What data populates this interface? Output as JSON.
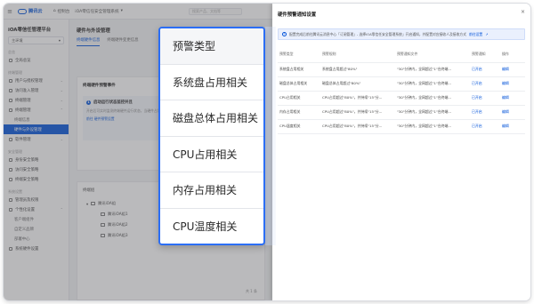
{
  "topnav": {
    "brand": "腾讯云",
    "console": "控制台",
    "app": "iOA零信任安全管理系统",
    "search_placeholder": "搜索产品、文档等"
  },
  "sidebar": {
    "title": "iOA零信任管理平台",
    "env": "主环境",
    "groups": [
      "总览",
      "终端管理",
      "安全管理",
      "系统设置"
    ],
    "items": [
      {
        "label": "全局总览",
        "level": 1
      },
      {
        "label": "用户与授权管理",
        "level": 1
      },
      {
        "label": "访问准入管理",
        "level": 1
      },
      {
        "label": "终端管理",
        "level": 1
      },
      {
        "label": "终端管理",
        "level": 1
      },
      {
        "label": "终端信息",
        "level": 2
      },
      {
        "label": "硬件与外设管理",
        "level": 2,
        "active": true
      },
      {
        "label": "软件管理",
        "level": 1
      },
      {
        "label": "身份安全策略",
        "level": 1
      },
      {
        "label": "访问安全策略",
        "level": 1
      },
      {
        "label": "终端安全策略",
        "level": 1
      },
      {
        "label": "管理员及权限",
        "level": 1
      },
      {
        "label": "个性化设置",
        "level": 1
      },
      {
        "label": "客户端组件",
        "level": 2
      },
      {
        "label": "自定义品牌",
        "level": 2
      },
      {
        "label": "部署中心",
        "level": 2
      },
      {
        "label": "系统硬件设置",
        "level": 1
      }
    ]
  },
  "main": {
    "page_title": "硬件与外设管理",
    "tabs": [
      "终端硬件信息",
      "终端硬件变更信息"
    ],
    "card_title": "终端硬件预警事件",
    "notice_title": "启动运行状态监控并且",
    "notice_desc": "开启后可实时监测终端硬件运行状态，当硬件占用超出阈值时进行告警提醒。",
    "notice_link": "前往 硬件预警设置",
    "tree_title": "终端组",
    "tree_nodes": [
      {
        "label": "腾讯iOA组",
        "level": 1
      },
      {
        "label": "腾讯iOA组1",
        "level": 2
      },
      {
        "label": "腾讯iOA组2",
        "level": 2
      },
      {
        "label": "腾讯iOA组3",
        "level": 2
      }
    ],
    "footer": "共 1 条"
  },
  "panel": {
    "title": "硬件预警通知设置",
    "banner_text": "配置完成后前往腾讯云消息中心「订阅管理」- 选择iOA零信任安全管理系统」开启通知，并配置对应接收人及接收方式",
    "banner_link": "前往设置",
    "columns": [
      "预警类型",
      "预警规则",
      "预警通知文件",
      "预警通知",
      "操作"
    ],
    "rows": [
      {
        "type": "系统盘占用相关",
        "rule": "系统盘占用超过\"80%\"",
        "notify": "\"30\"分钟内，全网超过\"1\"台终端...",
        "status": "已开启",
        "op": "编辑"
      },
      {
        "type": "磁盘总体占用相关",
        "rule": "磁盘总体占用超过\"80%\"",
        "notify": "\"30\"分钟内，全网超过\"1\"台终端...",
        "status": "已开启",
        "op": "编辑"
      },
      {
        "type": "CPU占用相关",
        "rule": "CPU占用超过\"80%\"，并持续\"15\"分...",
        "notify": "\"30\"分钟内，全网超过\"1\"台终端...",
        "status": "已开启",
        "op": "编辑"
      },
      {
        "type": "内存占用相关",
        "rule": "CPU占用超过\"80%\"，并持续\"15\"分...",
        "notify": "\"30\"分钟内，全网超过\"1\"台终端...",
        "status": "已开启",
        "op": "编辑"
      },
      {
        "type": "CPU温度相关",
        "rule": "CPU占用超过\"80%\"，并持续\"15\"分...",
        "notify": "\"30\"分钟内，全网超过\"1\"台终端...",
        "status": "已开启",
        "op": "编辑"
      }
    ]
  },
  "zoom": {
    "items": [
      "预警类型",
      "系统盘占用相关",
      "磁盘总体占用相关",
      "CPU占用相关",
      "内存占用相关",
      "CPU温度相关"
    ]
  },
  "colors": {
    "accent": "#0052d9",
    "callout_border": "#2b6ef5"
  }
}
